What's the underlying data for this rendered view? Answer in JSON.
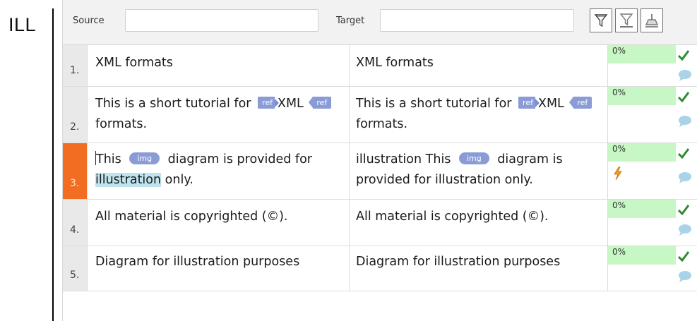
{
  "side_label": "ILL",
  "filter": {
    "source_label": "Source",
    "source_value": "",
    "target_label": "Target",
    "target_value": ""
  },
  "toolbar_icons": [
    "filter-icon",
    "filter-off-icon",
    "clear-filter-icon"
  ],
  "segments": [
    {
      "num": "1.",
      "source": [
        {
          "text": "XML formats"
        }
      ],
      "target": [
        {
          "text": "XML formats"
        }
      ],
      "match": "0%",
      "status_icons": [
        "confirmed-check-icon",
        "comment-icon"
      ]
    },
    {
      "num": "2.",
      "source": [
        {
          "text": "This is a short tutorial for "
        },
        {
          "tag": "ref",
          "kind": "open"
        },
        {
          "text": "XML "
        },
        {
          "tag": "ref",
          "kind": "close"
        },
        {
          "text": " formats."
        }
      ],
      "target": [
        {
          "text": "This is a short tutorial for "
        },
        {
          "tag": "ref",
          "kind": "open"
        },
        {
          "text": "XML "
        },
        {
          "tag": "ref",
          "kind": "close"
        },
        {
          "text": " formats."
        }
      ],
      "match": "0%",
      "status_icons": [
        "confirmed-check-icon",
        "comment-icon"
      ]
    },
    {
      "num": "3.",
      "active": true,
      "source": [
        {
          "caret": true
        },
        {
          "text": "This "
        },
        {
          "tag": "img",
          "kind": "pill"
        },
        {
          "text": " diagram is provided for "
        },
        {
          "text": "illustration",
          "highlight": true
        },
        {
          "text": " only."
        }
      ],
      "target": [
        {
          "text": "illustration This "
        },
        {
          "tag": "img",
          "kind": "pill"
        },
        {
          "text": " diagram is provided for illustration only."
        }
      ],
      "match": "0%",
      "status_icons": [
        "confirmed-check-icon",
        "warning-bolt-icon",
        "comment-icon"
      ]
    },
    {
      "num": "4.",
      "source": [
        {
          "text": "All material is copyrighted (©)."
        }
      ],
      "target": [
        {
          "text": "All material is copyrighted (©)."
        }
      ],
      "match": "0%",
      "status_icons": [
        "confirmed-check-icon",
        "comment-icon"
      ]
    },
    {
      "num": "5.",
      "source": [
        {
          "text": "Diagram for illustration purposes"
        }
      ],
      "target": [
        {
          "text": "Diagram for illustration purposes"
        }
      ],
      "match": "0%",
      "status_icons": [
        "confirmed-check-icon",
        "comment-icon"
      ]
    }
  ],
  "colors": {
    "active_segment": "#f26d21",
    "match_bg": "#c7f7c4",
    "check": "#2e8b2e",
    "comment": "#a9d3e8",
    "tag": "#8a9bd6",
    "highlight": "#bfe3ef"
  }
}
